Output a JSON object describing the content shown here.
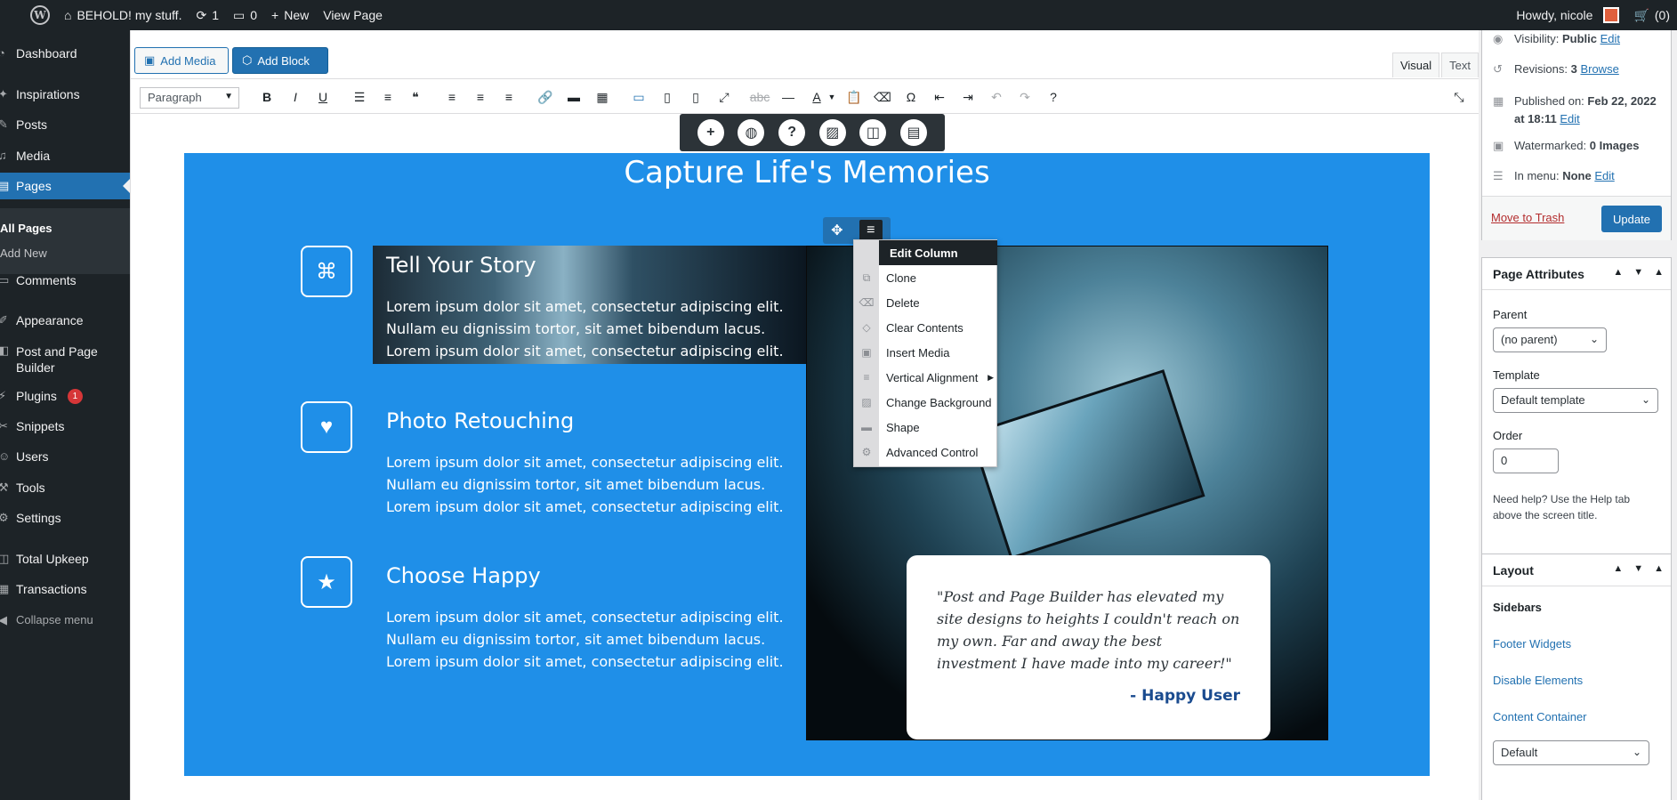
{
  "adminbar": {
    "site_name": "BEHOLD! my stuff.",
    "updates_count": "1",
    "comments_count": "0",
    "new_label": "New",
    "view_page_label": "View Page",
    "howdy": "Howdy, nicole",
    "cart": "(0)"
  },
  "menu": {
    "dashboard": "Dashboard",
    "inspirations": "Inspirations",
    "posts": "Posts",
    "media": "Media",
    "pages": "Pages",
    "all_pages": "All Pages",
    "add_new": "Add New",
    "comments": "Comments",
    "appearance": "Appearance",
    "ppb_line1": "Post and Page",
    "ppb_line2": "Builder",
    "plugins": "Plugins",
    "plugins_badge": "1",
    "snippets": "Snippets",
    "users": "Users",
    "tools": "Tools",
    "settings": "Settings",
    "total_upkeep": "Total Upkeep",
    "transactions": "Transactions",
    "collapse": "Collapse menu"
  },
  "editor": {
    "add_media": "Add Media",
    "add_block": "Add Block",
    "tab_visual": "Visual",
    "tab_text": "Text",
    "format_select": "Paragraph"
  },
  "content": {
    "section_title": "Capture Life's Memories",
    "features": [
      {
        "title": "Tell Your Story",
        "body": "Lorem ipsum dolor sit amet, consectetur adipiscing elit. Nullam eu dignissim tortor, sit amet bibendum lacus. Lorem ipsum dolor sit amet, consectetur adipiscing elit."
      },
      {
        "title": "Photo Retouching",
        "body": "Lorem ipsum dolor sit amet, consectetur adipiscing elit. Nullam eu dignissim tortor, sit amet bibendum lacus. Lorem ipsum dolor sit amet, consectetur adipiscing elit."
      },
      {
        "title": "Choose Happy",
        "body": "Lorem ipsum dolor sit amet, consectetur adipiscing elit. Nullam eu dignissim tortor, sit amet bibendum lacus. Lorem ipsum dolor sit amet, consectetur adipiscing elit."
      }
    ],
    "quote": "\"Post and Page Builder has elevated my site designs to heights I couldn't reach on my own. Far and away the best investment I have made into my career!\"",
    "quote_author": "- Happy User"
  },
  "context_menu": {
    "header": "Edit Column",
    "items": [
      "Clone",
      "Delete",
      "Clear Contents",
      "Insert Media",
      "Vertical Alignment",
      "Change Background",
      "Shape",
      "Advanced Control"
    ]
  },
  "sidebar": {
    "visibility_label": "Visibility:",
    "visibility_value": "Public",
    "edit": "Edit",
    "revisions_label": "Revisions:",
    "revisions_value": "3",
    "browse": "Browse",
    "published_label": "Published on:",
    "published_value": "Feb 22, 2022",
    "published_time": "at 18:11",
    "watermarked_label": "Watermarked:",
    "watermarked_value": "0 Images",
    "in_menu_label": "In menu:",
    "in_menu_value": "None",
    "move_to_trash": "Move to Trash",
    "update": "Update",
    "page_attributes": "Page Attributes",
    "parent_label": "Parent",
    "parent_value": "(no parent)",
    "template_label": "Template",
    "template_value": "Default template",
    "order_label": "Order",
    "order_value": "0",
    "help_text": "Need help? Use the Help tab above the screen title.",
    "layout_title": "Layout",
    "sidebars_label": "Sidebars",
    "footer_widgets": "Footer Widgets",
    "disable_elements": "Disable Elements",
    "content_container": "Content Container",
    "container_value": "Default"
  }
}
